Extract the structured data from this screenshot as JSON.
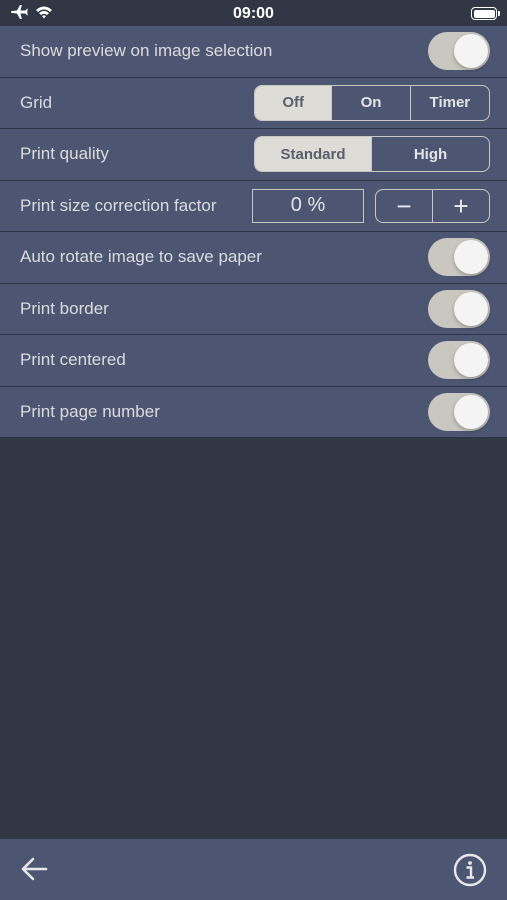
{
  "status_bar": {
    "time": "09:00",
    "left_icons": [
      "airplane-icon",
      "wifi-icon"
    ],
    "right_icons": [
      "battery-icon"
    ]
  },
  "settings": {
    "show_preview": {
      "label": "Show preview on image selection",
      "enabled": true
    },
    "grid": {
      "label": "Grid",
      "options": [
        "Off",
        "On",
        "Timer"
      ],
      "selected": "Off"
    },
    "print_quality": {
      "label": "Print quality",
      "options": [
        "Standard",
        "High"
      ],
      "selected": "Standard"
    },
    "size_correction": {
      "label": "Print size correction factor",
      "value": "0 %",
      "decrement": "−",
      "increment": "+"
    },
    "auto_rotate": {
      "label": "Auto rotate image to save paper",
      "enabled": true
    },
    "print_border": {
      "label": "Print border",
      "enabled": true
    },
    "print_centered": {
      "label": "Print centered",
      "enabled": true
    },
    "print_page_number": {
      "label": "Print page number",
      "enabled": true
    }
  },
  "bottom_bar": {
    "icons": [
      "back-arrow-icon",
      "info-icon"
    ]
  },
  "colors": {
    "panel": "#4c5673",
    "background": "#313745",
    "toggle_track": "#c9c7bf",
    "segment_selected": "#dddcd6"
  }
}
